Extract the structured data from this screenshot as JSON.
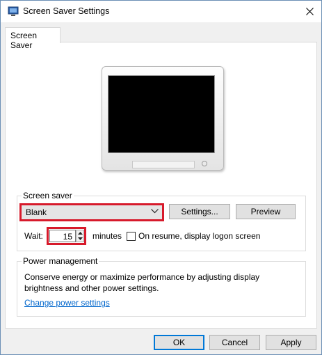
{
  "window": {
    "title": "Screen Saver Settings"
  },
  "tabs": [
    {
      "label": "Screen Saver"
    }
  ],
  "screen_saver": {
    "group_label": "Screen saver",
    "selected": "Blank",
    "settings_label": "Settings...",
    "preview_label": "Preview",
    "wait_label": "Wait:",
    "wait_value": "15",
    "minutes_label": "minutes",
    "resume_label": "On resume, display logon screen",
    "resume_checked": false
  },
  "power": {
    "group_label": "Power management",
    "description": "Conserve energy or maximize performance by adjusting display brightness and other power settings.",
    "link": "Change power settings"
  },
  "footer": {
    "ok_label": "OK",
    "cancel_label": "Cancel",
    "apply_label": "Apply"
  },
  "colors": {
    "highlight": "#d71a2b",
    "link": "#0066cc",
    "default_button_border": "#0078d7"
  }
}
